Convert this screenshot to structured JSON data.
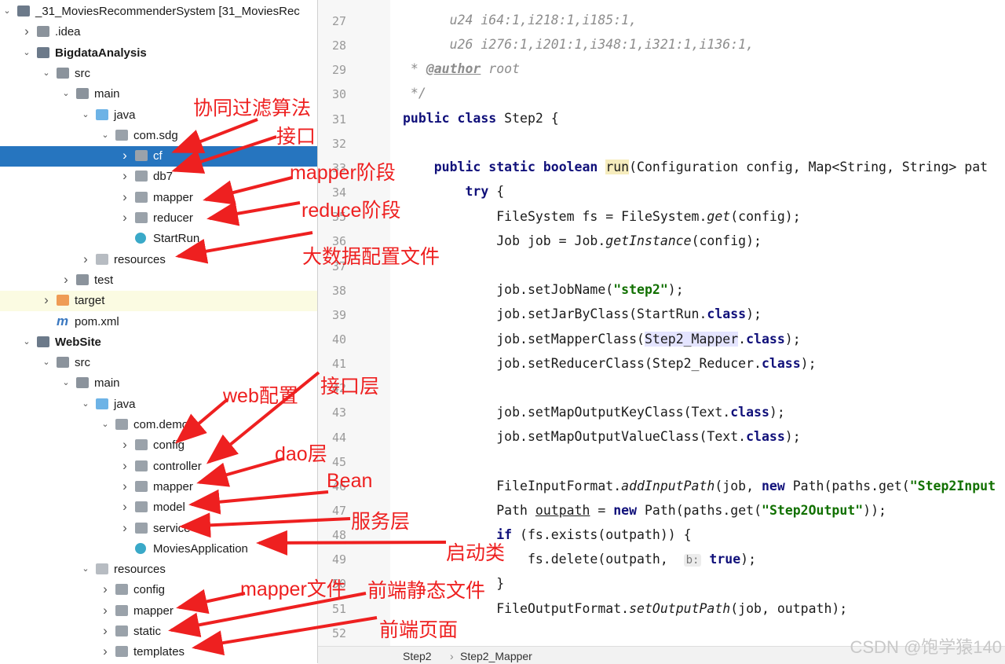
{
  "tree": [
    {
      "label": "_31_MoviesRecommenderSystem [31_MoviesRec",
      "icon": "module-folder-icon",
      "bold": false
    },
    {
      "label": ".idea",
      "icon": "folder-icon"
    },
    {
      "label": "BigdataAnalysis",
      "icon": "module-folder-icon",
      "bold": true
    },
    {
      "label": "src",
      "icon": "folder-icon"
    },
    {
      "label": "main",
      "icon": "folder-icon"
    },
    {
      "label": "java",
      "icon": "source-folder-icon"
    },
    {
      "label": "com.sdg",
      "icon": "package-icon"
    },
    {
      "label": "cf",
      "icon": "package-icon",
      "selected": true
    },
    {
      "label": "db7",
      "icon": "package-icon"
    },
    {
      "label": "mapper",
      "icon": "package-icon"
    },
    {
      "label": "reducer",
      "icon": "package-icon"
    },
    {
      "label": "StartRun",
      "icon": "class-icon"
    },
    {
      "label": "resources",
      "icon": "resources-folder-icon"
    },
    {
      "label": "test",
      "icon": "folder-icon"
    },
    {
      "label": "target",
      "icon": "target-folder-icon"
    },
    {
      "label": "pom.xml",
      "icon": "maven-icon"
    },
    {
      "label": "WebSite",
      "icon": "module-folder-icon",
      "bold": true
    },
    {
      "label": "src",
      "icon": "folder-icon"
    },
    {
      "label": "main",
      "icon": "folder-icon"
    },
    {
      "label": "java",
      "icon": "source-folder-icon"
    },
    {
      "label": "com.demo",
      "icon": "package-icon"
    },
    {
      "label": "config",
      "icon": "package-icon"
    },
    {
      "label": "controller",
      "icon": "package-icon"
    },
    {
      "label": "mapper",
      "icon": "package-icon"
    },
    {
      "label": "model",
      "icon": "package-icon"
    },
    {
      "label": "service",
      "icon": "package-icon"
    },
    {
      "label": "MoviesApplication",
      "icon": "class-icon"
    },
    {
      "label": "resources",
      "icon": "resources-folder-icon"
    },
    {
      "label": "config",
      "icon": "package-icon"
    },
    {
      "label": "mapper",
      "icon": "package-icon"
    },
    {
      "label": "static",
      "icon": "package-icon"
    },
    {
      "label": "templates",
      "icon": "package-icon"
    }
  ],
  "editor": {
    "line_numbers": [
      "27",
      "28",
      "29",
      "30",
      "31",
      "32",
      "33",
      "34",
      "35",
      "36",
      "37",
      "38",
      "39",
      "40",
      "41",
      "42",
      "43",
      "44",
      "45",
      "46",
      "47",
      "48",
      "49",
      "50",
      "51",
      "52"
    ],
    "breadcrumb": [
      "Step2",
      "Step2_Mapper"
    ],
    "hint_b": "b:"
  },
  "annotations": {
    "a1": "协同过滤算法",
    "a2": "接口",
    "a3": "mapper阶段",
    "a4": "reduce阶段",
    "a5": "大数据配置文件",
    "a6": "web配置",
    "a7": "接口层",
    "a8": "dao层",
    "a9": "Bean",
    "a10": "服务层",
    "a11": "启动类",
    "a12": "mapper文件",
    "a13": "前端静态文件",
    "a14": "前端页面"
  },
  "watermark": "CSDN @饱学猿140",
  "colors": {
    "selection": "#2675bf",
    "annotation": "#ee2020",
    "keyword": "#10107a",
    "string": "#117000"
  }
}
